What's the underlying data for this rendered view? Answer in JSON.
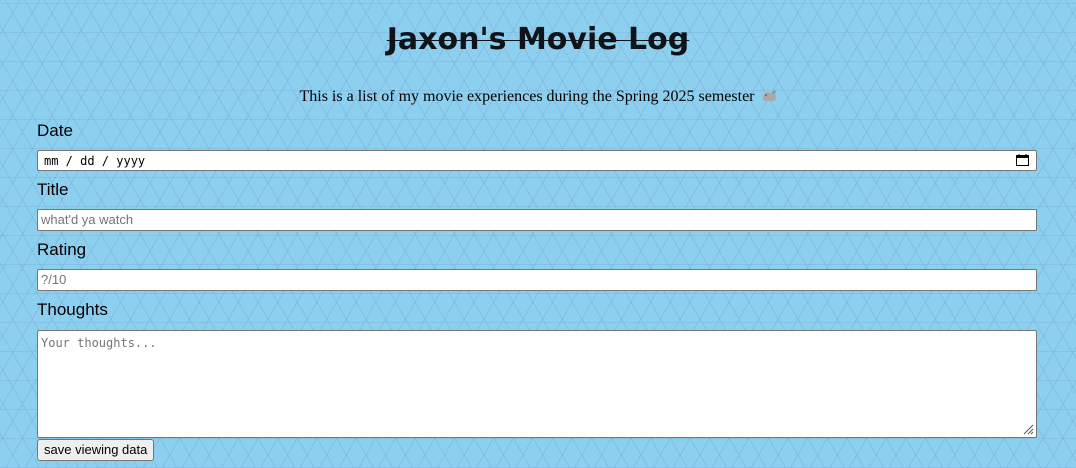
{
  "header": {
    "title": "Jaxon's Movie Log",
    "subtitle": "This is a list of my movie experiences during the Spring 2025 semester",
    "subtitle_emoji_icon": "squirrel-emoji-icon"
  },
  "form": {
    "date": {
      "label": "Date",
      "placeholder": "mm / dd / yyyy",
      "icon": "calendar-icon"
    },
    "title": {
      "label": "Title",
      "placeholder": "what'd ya watch"
    },
    "rating": {
      "label": "Rating",
      "placeholder": "?/10"
    },
    "thoughts": {
      "label": "Thoughts",
      "placeholder": "Your thoughts..."
    },
    "submit_label": "save viewing data"
  },
  "colors": {
    "background": "#8ccfee",
    "pattern": "#78aad7"
  }
}
